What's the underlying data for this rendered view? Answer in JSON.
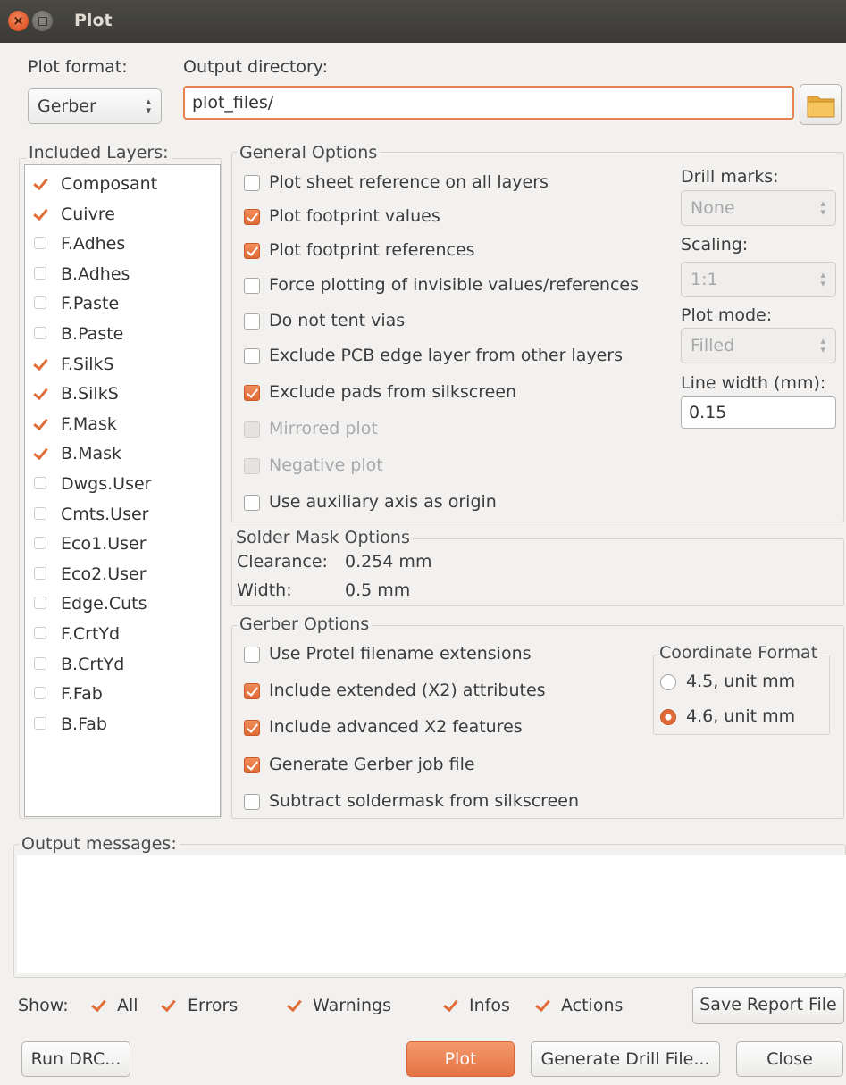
{
  "window": {
    "title": "Plot"
  },
  "plot_format": {
    "label": "Plot format:",
    "value": "Gerber"
  },
  "output_directory": {
    "label": "Output directory:",
    "value": "plot_files/"
  },
  "layers": {
    "label": "Included Layers:",
    "items": [
      {
        "name": "Composant",
        "checked": true
      },
      {
        "name": "Cuivre",
        "checked": true
      },
      {
        "name": "F.Adhes",
        "checked": false
      },
      {
        "name": "B.Adhes",
        "checked": false
      },
      {
        "name": "F.Paste",
        "checked": false
      },
      {
        "name": "B.Paste",
        "checked": false
      },
      {
        "name": "F.SilkS",
        "checked": true
      },
      {
        "name": "B.SilkS",
        "checked": true
      },
      {
        "name": "F.Mask",
        "checked": true
      },
      {
        "name": "B.Mask",
        "checked": true
      },
      {
        "name": "Dwgs.User",
        "checked": false
      },
      {
        "name": "Cmts.User",
        "checked": false
      },
      {
        "name": "Eco1.User",
        "checked": false
      },
      {
        "name": "Eco2.User",
        "checked": false
      },
      {
        "name": "Edge.Cuts",
        "checked": false
      },
      {
        "name": "F.CrtYd",
        "checked": false
      },
      {
        "name": "B.CrtYd",
        "checked": false
      },
      {
        "name": "F.Fab",
        "checked": false
      },
      {
        "name": "B.Fab",
        "checked": false
      }
    ]
  },
  "general": {
    "title": "General Options",
    "options": [
      {
        "label": "Plot sheet reference on all layers",
        "checked": false,
        "enabled": true
      },
      {
        "label": "Plot footprint values",
        "checked": true,
        "enabled": true
      },
      {
        "label": "Plot footprint references",
        "checked": true,
        "enabled": true
      },
      {
        "label": "Force plotting of invisible values/references",
        "checked": false,
        "enabled": true
      },
      {
        "label": "Do not tent vias",
        "checked": false,
        "enabled": true
      },
      {
        "label": "Exclude PCB edge layer from other layers",
        "checked": false,
        "enabled": true
      },
      {
        "label": "Exclude pads from silkscreen",
        "checked": true,
        "enabled": true
      },
      {
        "label": "Mirrored plot",
        "checked": false,
        "enabled": false
      },
      {
        "label": "Negative plot",
        "checked": false,
        "enabled": false
      },
      {
        "label": "Use auxiliary axis as origin",
        "checked": false,
        "enabled": true
      }
    ],
    "drill_marks": {
      "label": "Drill marks:",
      "value": "None"
    },
    "scaling": {
      "label": "Scaling:",
      "value": "1:1"
    },
    "plot_mode": {
      "label": "Plot mode:",
      "value": "Filled"
    },
    "line_width": {
      "label": "Line width (mm):",
      "value": "0.15"
    }
  },
  "solder_mask": {
    "title": "Solder Mask Options",
    "clearance_label": "Clearance:",
    "clearance_value": "0.254 mm",
    "width_label": "Width:",
    "width_value": "0.5 mm"
  },
  "gerber": {
    "title": "Gerber Options",
    "options": [
      {
        "label": "Use Protel filename extensions",
        "checked": false
      },
      {
        "label": "Include extended (X2) attributes",
        "checked": true
      },
      {
        "label": "Include advanced X2 features",
        "checked": true
      },
      {
        "label": "Generate Gerber job file",
        "checked": true
      },
      {
        "label": "Subtract soldermask from silkscreen",
        "checked": false
      }
    ],
    "coordinate_format": {
      "title": "Coordinate Format",
      "options": [
        {
          "label": "4.5, unit mm",
          "selected": false
        },
        {
          "label": "4.6, unit mm",
          "selected": true
        }
      ]
    }
  },
  "output_messages": {
    "label": "Output messages:"
  },
  "show_filters": {
    "label": "Show:",
    "items": [
      {
        "label": "All",
        "checked": true
      },
      {
        "label": "Errors",
        "checked": true
      },
      {
        "label": "Warnings",
        "checked": true
      },
      {
        "label": "Infos",
        "checked": true
      },
      {
        "label": "Actions",
        "checked": true
      }
    ],
    "save_report": "Save Report File"
  },
  "buttons": {
    "run_drc": "Run DRC...",
    "plot": "Plot",
    "generate_drill": "Generate Drill File...",
    "close": "Close"
  }
}
